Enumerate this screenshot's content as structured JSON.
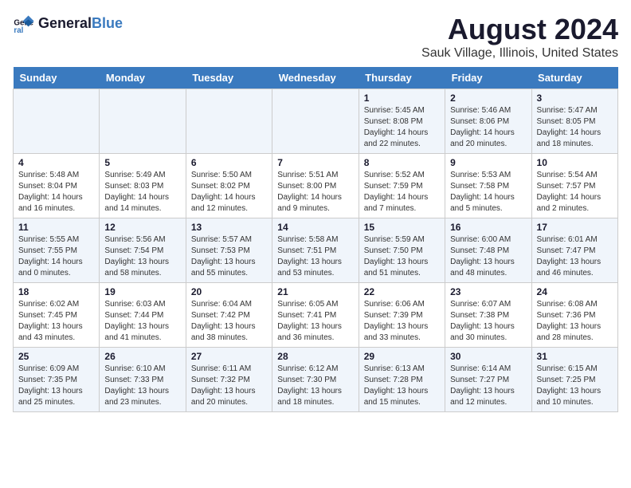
{
  "logo": {
    "text_general": "General",
    "text_blue": "Blue"
  },
  "header": {
    "title": "August 2024",
    "subtitle": "Sauk Village, Illinois, United States"
  },
  "weekdays": [
    "Sunday",
    "Monday",
    "Tuesday",
    "Wednesday",
    "Thursday",
    "Friday",
    "Saturday"
  ],
  "weeks": [
    [
      {
        "day": "",
        "info": ""
      },
      {
        "day": "",
        "info": ""
      },
      {
        "day": "",
        "info": ""
      },
      {
        "day": "",
        "info": ""
      },
      {
        "day": "1",
        "info": "Sunrise: 5:45 AM\nSunset: 8:08 PM\nDaylight: 14 hours\nand 22 minutes."
      },
      {
        "day": "2",
        "info": "Sunrise: 5:46 AM\nSunset: 8:06 PM\nDaylight: 14 hours\nand 20 minutes."
      },
      {
        "day": "3",
        "info": "Sunrise: 5:47 AM\nSunset: 8:05 PM\nDaylight: 14 hours\nand 18 minutes."
      }
    ],
    [
      {
        "day": "4",
        "info": "Sunrise: 5:48 AM\nSunset: 8:04 PM\nDaylight: 14 hours\nand 16 minutes."
      },
      {
        "day": "5",
        "info": "Sunrise: 5:49 AM\nSunset: 8:03 PM\nDaylight: 14 hours\nand 14 minutes."
      },
      {
        "day": "6",
        "info": "Sunrise: 5:50 AM\nSunset: 8:02 PM\nDaylight: 14 hours\nand 12 minutes."
      },
      {
        "day": "7",
        "info": "Sunrise: 5:51 AM\nSunset: 8:00 PM\nDaylight: 14 hours\nand 9 minutes."
      },
      {
        "day": "8",
        "info": "Sunrise: 5:52 AM\nSunset: 7:59 PM\nDaylight: 14 hours\nand 7 minutes."
      },
      {
        "day": "9",
        "info": "Sunrise: 5:53 AM\nSunset: 7:58 PM\nDaylight: 14 hours\nand 5 minutes."
      },
      {
        "day": "10",
        "info": "Sunrise: 5:54 AM\nSunset: 7:57 PM\nDaylight: 14 hours\nand 2 minutes."
      }
    ],
    [
      {
        "day": "11",
        "info": "Sunrise: 5:55 AM\nSunset: 7:55 PM\nDaylight: 14 hours\nand 0 minutes."
      },
      {
        "day": "12",
        "info": "Sunrise: 5:56 AM\nSunset: 7:54 PM\nDaylight: 13 hours\nand 58 minutes."
      },
      {
        "day": "13",
        "info": "Sunrise: 5:57 AM\nSunset: 7:53 PM\nDaylight: 13 hours\nand 55 minutes."
      },
      {
        "day": "14",
        "info": "Sunrise: 5:58 AM\nSunset: 7:51 PM\nDaylight: 13 hours\nand 53 minutes."
      },
      {
        "day": "15",
        "info": "Sunrise: 5:59 AM\nSunset: 7:50 PM\nDaylight: 13 hours\nand 51 minutes."
      },
      {
        "day": "16",
        "info": "Sunrise: 6:00 AM\nSunset: 7:48 PM\nDaylight: 13 hours\nand 48 minutes."
      },
      {
        "day": "17",
        "info": "Sunrise: 6:01 AM\nSunset: 7:47 PM\nDaylight: 13 hours\nand 46 minutes."
      }
    ],
    [
      {
        "day": "18",
        "info": "Sunrise: 6:02 AM\nSunset: 7:45 PM\nDaylight: 13 hours\nand 43 minutes."
      },
      {
        "day": "19",
        "info": "Sunrise: 6:03 AM\nSunset: 7:44 PM\nDaylight: 13 hours\nand 41 minutes."
      },
      {
        "day": "20",
        "info": "Sunrise: 6:04 AM\nSunset: 7:42 PM\nDaylight: 13 hours\nand 38 minutes."
      },
      {
        "day": "21",
        "info": "Sunrise: 6:05 AM\nSunset: 7:41 PM\nDaylight: 13 hours\nand 36 minutes."
      },
      {
        "day": "22",
        "info": "Sunrise: 6:06 AM\nSunset: 7:39 PM\nDaylight: 13 hours\nand 33 minutes."
      },
      {
        "day": "23",
        "info": "Sunrise: 6:07 AM\nSunset: 7:38 PM\nDaylight: 13 hours\nand 30 minutes."
      },
      {
        "day": "24",
        "info": "Sunrise: 6:08 AM\nSunset: 7:36 PM\nDaylight: 13 hours\nand 28 minutes."
      }
    ],
    [
      {
        "day": "25",
        "info": "Sunrise: 6:09 AM\nSunset: 7:35 PM\nDaylight: 13 hours\nand 25 minutes."
      },
      {
        "day": "26",
        "info": "Sunrise: 6:10 AM\nSunset: 7:33 PM\nDaylight: 13 hours\nand 23 minutes."
      },
      {
        "day": "27",
        "info": "Sunrise: 6:11 AM\nSunset: 7:32 PM\nDaylight: 13 hours\nand 20 minutes."
      },
      {
        "day": "28",
        "info": "Sunrise: 6:12 AM\nSunset: 7:30 PM\nDaylight: 13 hours\nand 18 minutes."
      },
      {
        "day": "29",
        "info": "Sunrise: 6:13 AM\nSunset: 7:28 PM\nDaylight: 13 hours\nand 15 minutes."
      },
      {
        "day": "30",
        "info": "Sunrise: 6:14 AM\nSunset: 7:27 PM\nDaylight: 13 hours\nand 12 minutes."
      },
      {
        "day": "31",
        "info": "Sunrise: 6:15 AM\nSunset: 7:25 PM\nDaylight: 13 hours\nand 10 minutes."
      }
    ]
  ]
}
